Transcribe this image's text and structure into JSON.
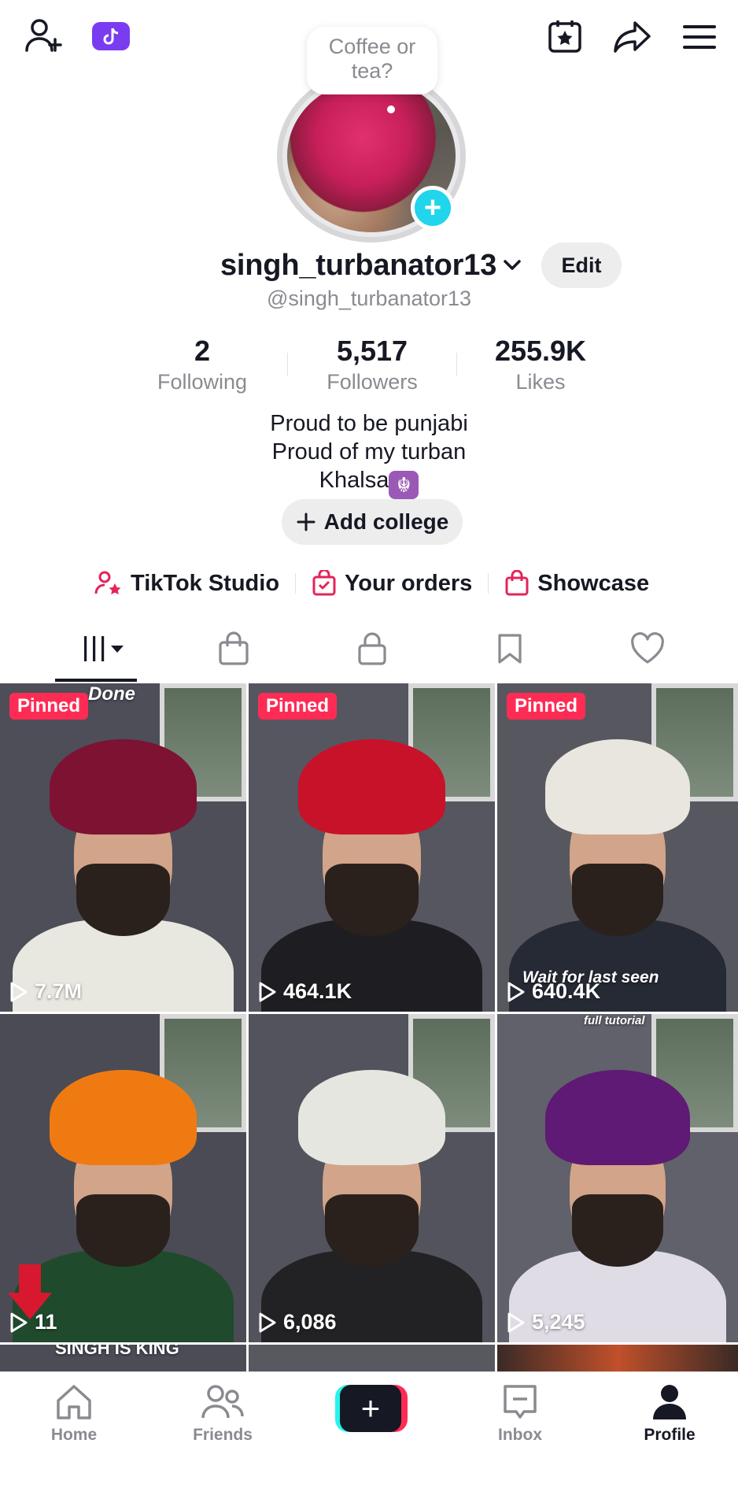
{
  "avatar": {
    "bubble_text": "Coffee or tea?",
    "add_symbol": "+"
  },
  "profile": {
    "username": "singh_turbanator13",
    "handle": "@singh_turbanator13",
    "edit_label": "Edit",
    "stats": [
      {
        "value": "2",
        "label": "Following"
      },
      {
        "value": "5,517",
        "label": "Followers"
      },
      {
        "value": "255.9K",
        "label": "Likes"
      }
    ],
    "bio": [
      "Proud to be punjabi",
      "Proud of my turban",
      "Khalsa"
    ],
    "bio_emoji": "☬",
    "add_college_label": "Add college"
  },
  "shortcuts": [
    {
      "label": "TikTok Studio",
      "icon": "person-star-icon"
    },
    {
      "label": "Your orders",
      "icon": "order-bag-icon"
    },
    {
      "label": "Showcase",
      "icon": "shopping-bag-icon"
    }
  ],
  "tabs": [
    "videos",
    "shop",
    "private",
    "saved",
    "liked"
  ],
  "videos": [
    {
      "pinned": "Pinned",
      "views": "7.7M",
      "overlay": "Done",
      "turban": "#7d1233",
      "shirt": "#e8e8e0",
      "bg": "#4d4e58"
    },
    {
      "pinned": "Pinned",
      "views": "464.1K",
      "overlay": "",
      "turban": "#c8122a",
      "shirt": "#1e1e22",
      "bg": "#55565f"
    },
    {
      "pinned": "Pinned",
      "views": "640.4K",
      "overlay": "Wait for last seen",
      "turban": "#e8e6df",
      "shirt": "#262a35",
      "bg": "#57585f"
    },
    {
      "pinned": "",
      "views": "11",
      "overlay": "SINGH IS KING",
      "turban": "#f07a12",
      "shirt": "#1f4a2c",
      "bg": "#4a4b55"
    },
    {
      "pinned": "",
      "views": "6,086",
      "overlay": "",
      "turban": "#e6e6e1",
      "shirt": "#222225",
      "bg": "#52535c"
    },
    {
      "pinned": "",
      "views": "5,245",
      "overlay": "full tutorial",
      "turban": "#5e1a74",
      "shirt": "#e0dce6",
      "bg": "#60616a"
    }
  ],
  "nav": [
    {
      "label": "Home",
      "icon": "home-icon"
    },
    {
      "label": "Friends",
      "icon": "friends-icon"
    },
    {
      "label": "",
      "icon": "create-icon"
    },
    {
      "label": "Inbox",
      "icon": "inbox-icon"
    },
    {
      "label": "Profile",
      "icon": "profile-icon"
    }
  ],
  "colors": {
    "accent": "#fe2c55",
    "cyan": "#25f4ee",
    "text": "#161823",
    "muted": "#8a8b91"
  }
}
